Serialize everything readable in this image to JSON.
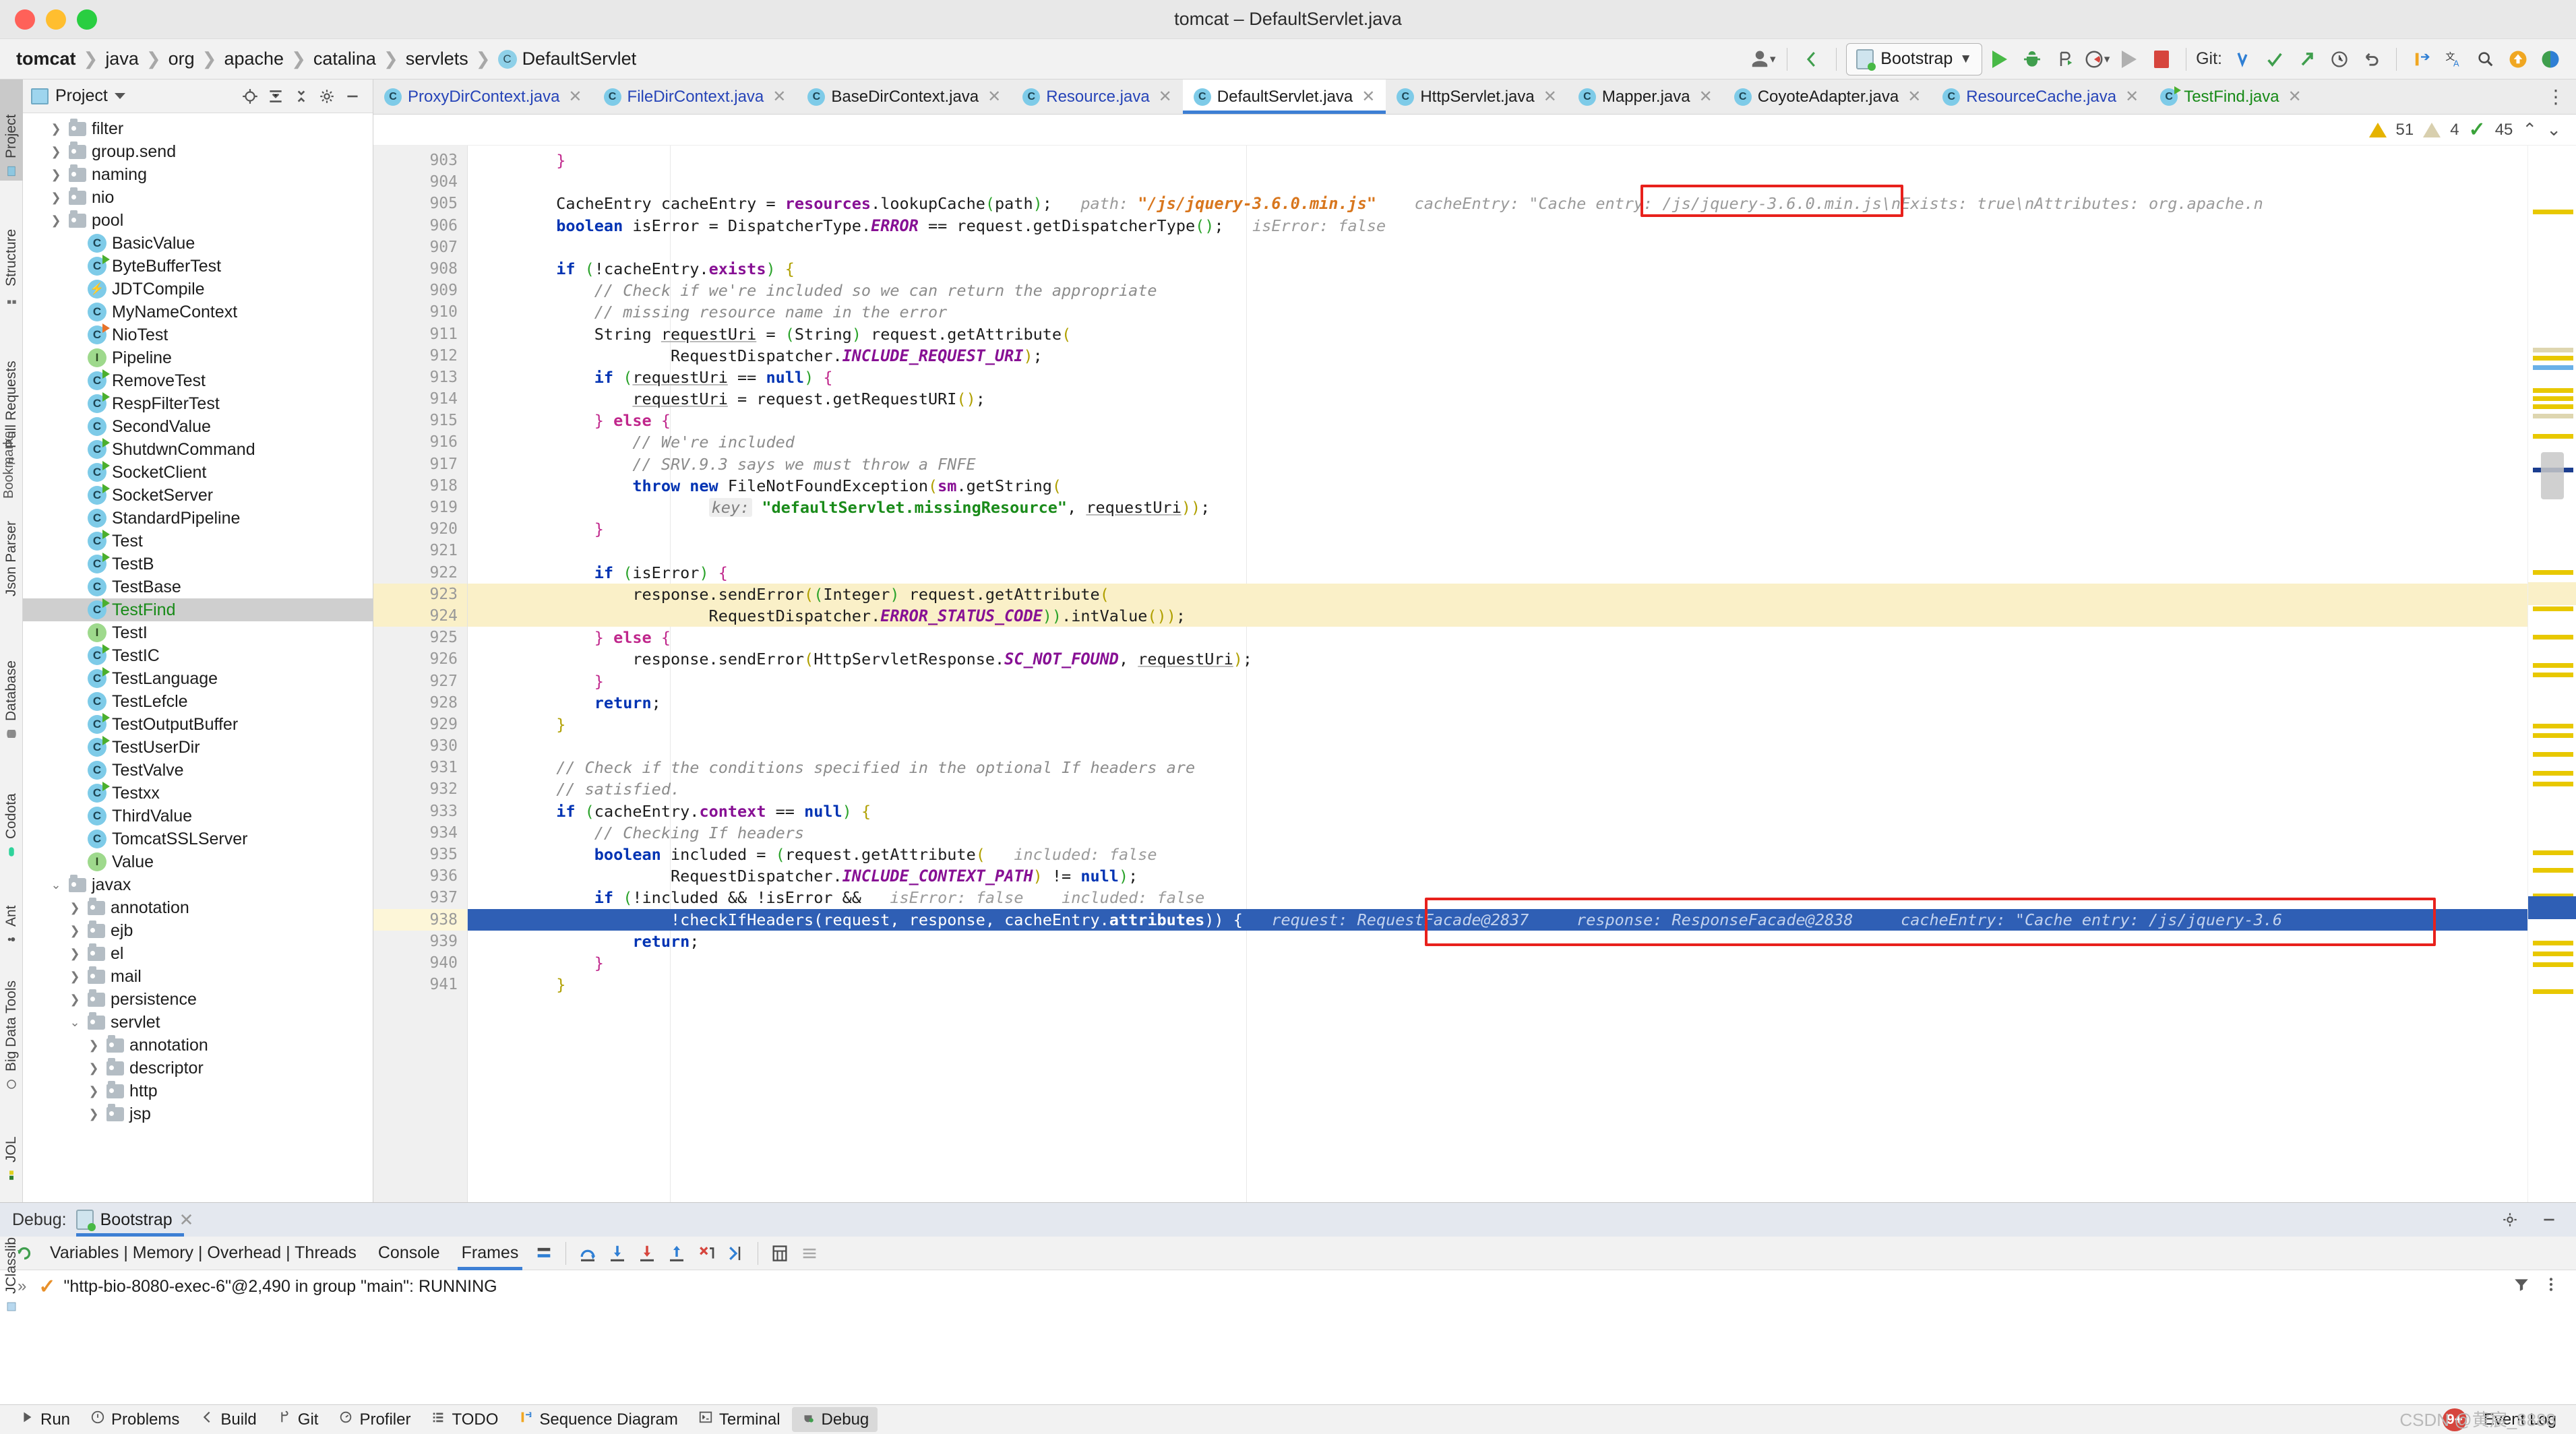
{
  "window": {
    "title": "tomcat – DefaultServlet.java",
    "traffic_lights": [
      "close",
      "minimize",
      "zoom"
    ]
  },
  "breadcrumb": {
    "items": [
      {
        "label": "tomcat",
        "bold": true
      },
      {
        "label": "java"
      },
      {
        "label": "org"
      },
      {
        "label": "apache"
      },
      {
        "label": "catalina"
      },
      {
        "label": "servlets"
      },
      {
        "label": "DefaultServlet",
        "icon": "class-icon"
      }
    ]
  },
  "toolbar": {
    "run_config": "Bootstrap",
    "git_label": "Git:",
    "icons": [
      "user-avatar-icon",
      "back-arrow-icon",
      "run-icon",
      "debug-icon",
      "run-with-coverage-icon",
      "profile-icon",
      "attach-icon",
      "stop-icon",
      "git-update-icon",
      "git-commit-icon",
      "git-push-icon",
      "git-history-icon",
      "git-rollback-icon",
      "git-branch-icon",
      "translate-icon",
      "search-icon",
      "update-icon",
      "settings-icon"
    ]
  },
  "left_tool_tabs": [
    {
      "label": "Project",
      "active": true,
      "icon": "project-icon"
    },
    {
      "label": "Structure",
      "active": false,
      "icon": "structure-icon"
    },
    {
      "label": "Pull Requests",
      "active": false,
      "icon": "pull-request-icon"
    },
    {
      "label": "Json Parser",
      "active": false,
      "icon": "json-icon"
    },
    {
      "label": "Database",
      "active": false,
      "icon": "database-icon"
    },
    {
      "label": "Codota",
      "active": false,
      "icon": "codota-icon"
    },
    {
      "label": "Ant",
      "active": false,
      "icon": "ant-icon"
    },
    {
      "label": "Big Data Tools",
      "active": false,
      "icon": "bigdata-icon"
    },
    {
      "label": "JOL",
      "active": false,
      "icon": "jol-icon"
    },
    {
      "label": "JClasslib",
      "active": false,
      "icon": "jclasslib-icon"
    }
  ],
  "project_panel": {
    "title": "Project",
    "header_icons": [
      "locate-icon",
      "expand-all-icon",
      "collapse-all-icon",
      "gear-icon",
      "hide-icon"
    ],
    "tree": [
      {
        "label": "filter",
        "type": "folder",
        "depth": 1,
        "arrow": "collapsed"
      },
      {
        "label": "group.send",
        "type": "folder",
        "depth": 1,
        "arrow": "collapsed"
      },
      {
        "label": "naming",
        "type": "folder",
        "depth": 1,
        "arrow": "collapsed"
      },
      {
        "label": "nio",
        "type": "folder",
        "depth": 1,
        "arrow": "collapsed"
      },
      {
        "label": "pool",
        "type": "folder",
        "depth": 1,
        "arrow": "collapsed"
      },
      {
        "label": "BasicValue",
        "type": "class",
        "depth": 2
      },
      {
        "label": "ByteBufferTest",
        "type": "class-runnable",
        "depth": 2
      },
      {
        "label": "JDTCompile",
        "type": "bolt",
        "depth": 2
      },
      {
        "label": "MyNameContext",
        "type": "class",
        "depth": 2
      },
      {
        "label": "NioTest",
        "type": "class-runnable-orange",
        "depth": 2
      },
      {
        "label": "Pipeline",
        "type": "interface",
        "depth": 2
      },
      {
        "label": "RemoveTest",
        "type": "class-runnable",
        "depth": 2
      },
      {
        "label": "RespFilterTest",
        "type": "class-runnable",
        "depth": 2
      },
      {
        "label": "SecondValue",
        "type": "class",
        "depth": 2
      },
      {
        "label": "ShutdwnCommand",
        "type": "class-runnable",
        "depth": 2
      },
      {
        "label": "SocketClient",
        "type": "class-runnable",
        "depth": 2
      },
      {
        "label": "SocketServer",
        "type": "class-runnable",
        "depth": 2
      },
      {
        "label": "StandardPipeline",
        "type": "class",
        "depth": 2
      },
      {
        "label": "Test",
        "type": "class-runnable",
        "depth": 2
      },
      {
        "label": "TestB",
        "type": "class-runnable",
        "depth": 2
      },
      {
        "label": "TestBase",
        "type": "class",
        "depth": 2
      },
      {
        "label": "TestFind",
        "type": "class-runnable",
        "depth": 2,
        "selected": true
      },
      {
        "label": "TestI",
        "type": "interface",
        "depth": 2
      },
      {
        "label": "TestIC",
        "type": "class-runnable",
        "depth": 2
      },
      {
        "label": "TestLanguage",
        "type": "class-runnable",
        "depth": 2
      },
      {
        "label": "TestLefcle",
        "type": "class",
        "depth": 2
      },
      {
        "label": "TestOutputBuffer",
        "type": "class-runnable",
        "depth": 2
      },
      {
        "label": "TestUserDir",
        "type": "class-runnable",
        "depth": 2
      },
      {
        "label": "TestValve",
        "type": "class",
        "depth": 2
      },
      {
        "label": "Testxx",
        "type": "class-runnable",
        "depth": 2
      },
      {
        "label": "ThirdValue",
        "type": "class",
        "depth": 2
      },
      {
        "label": "TomcatSSLServer",
        "type": "class",
        "depth": 2
      },
      {
        "label": "Value",
        "type": "interface",
        "depth": 2
      },
      {
        "label": "javax",
        "type": "folder",
        "depth": 1,
        "arrow": "expanded"
      },
      {
        "label": "annotation",
        "type": "folder",
        "depth": 2,
        "arrow": "collapsed"
      },
      {
        "label": "ejb",
        "type": "folder",
        "depth": 2,
        "arrow": "collapsed"
      },
      {
        "label": "el",
        "type": "folder",
        "depth": 2,
        "arrow": "collapsed"
      },
      {
        "label": "mail",
        "type": "folder",
        "depth": 2,
        "arrow": "collapsed"
      },
      {
        "label": "persistence",
        "type": "folder",
        "depth": 2,
        "arrow": "collapsed"
      },
      {
        "label": "servlet",
        "type": "folder",
        "depth": 2,
        "arrow": "expanded"
      },
      {
        "label": "annotation",
        "type": "folder",
        "depth": 3,
        "arrow": "collapsed"
      },
      {
        "label": "descriptor",
        "type": "folder",
        "depth": 3,
        "arrow": "collapsed"
      },
      {
        "label": "http",
        "type": "folder",
        "depth": 3,
        "arrow": "collapsed"
      },
      {
        "label": "jsp",
        "type": "folder",
        "depth": 3,
        "arrow": "collapsed"
      }
    ]
  },
  "editor_tabs": [
    {
      "label": "ProxyDirContext.java",
      "active": false,
      "color": "blue"
    },
    {
      "label": "FileDirContext.java",
      "active": false,
      "color": "blue"
    },
    {
      "label": "BaseDirContext.java",
      "active": false,
      "color": "black"
    },
    {
      "label": "Resource.java",
      "active": false,
      "color": "blue"
    },
    {
      "label": "DefaultServlet.java",
      "active": true,
      "color": "black"
    },
    {
      "label": "HttpServlet.java",
      "active": false,
      "color": "black"
    },
    {
      "label": "Mapper.java",
      "active": false,
      "color": "black"
    },
    {
      "label": "CoyoteAdapter.java",
      "active": false,
      "color": "black"
    },
    {
      "label": "ResourceCache.java",
      "active": false,
      "color": "blue"
    },
    {
      "label": "TestFind.java",
      "active": false,
      "color": "green"
    }
  ],
  "inspection": {
    "warnings": "51",
    "weak_warnings": "4",
    "passed": "45"
  },
  "code": {
    "first_line_number": 903,
    "highlighted_execution_line": 938,
    "search_highlight_lines": [
      923,
      924
    ],
    "lines": [
      {
        "n": 903,
        "html": "        <span class='par3'>}</span>"
      },
      {
        "n": 904,
        "html": ""
      },
      {
        "n": 905,
        "html": "        CacheEntry cacheEntry = <span class='fld'>resources</span>.lookupCache<span class='par2'>(</span>path<span class='par2'>)</span>;   <span class='hint'>path:</span> <span class='orangestr'>\"/js/jquery-3.6.0.min.js\"</span>    <span class='hint'>cacheEntry: \"Cache entry: /js/jquery-3.6.0.min.js\\nExists: true\\nAttributes: org.apache.n</span>"
      },
      {
        "n": 906,
        "html": "        <span class='kw'>boolean</span> isError = DispatcherType.<span class='fldi'>ERROR</span> == request.getDispatcherType<span class='par2'>()</span>;   <span class='hint'>isError: false</span>"
      },
      {
        "n": 907,
        "html": ""
      },
      {
        "n": 908,
        "html": "        <span class='kw'>if</span> <span class='par2'>(</span>!cacheEntry.<span class='fld'>exists</span><span class='par2'>)</span> <span class='par'>{</span>"
      },
      {
        "n": 909,
        "html": "            <span class='cmt'>// Check if we're included so we can return the appropriate</span>"
      },
      {
        "n": 910,
        "html": "            <span class='cmt'>// missing resource name in the error</span>"
      },
      {
        "n": 911,
        "html": "            String <span class='und'>requestUri</span> = <span class='par2'>(</span>String<span class='par2'>)</span> request.getAttribute<span class='par'>(</span>"
      },
      {
        "n": 912,
        "html": "                    RequestDispatcher.<span class='fldi'>INCLUDE_REQUEST_URI</span><span class='par'>)</span>;"
      },
      {
        "n": 913,
        "html": "            <span class='kw'>if</span> <span class='par2'>(</span><span class='und'>requestUri</span> == <span class='kw'>null</span><span class='par2'>)</span> <span class='par3'>{</span>"
      },
      {
        "n": 914,
        "html": "                <span class='und'>requestUri</span> = request.getRequestURI<span class='par'>()</span>;"
      },
      {
        "n": 915,
        "html": "            <span class='par3'>}</span> <span class='kw2'>else</span> <span class='par3'>{</span>"
      },
      {
        "n": 916,
        "html": "                <span class='cmt'>// We're included</span>"
      },
      {
        "n": 917,
        "html": "                <span class='cmt'>// SRV.9.3 says we must throw a FNFE</span>"
      },
      {
        "n": 918,
        "html": "                <span class='kw'>throw new</span> FileNotFoundException<span class='par'>(</span><span class='fld'>sm</span>.getString<span class='par'>(</span>"
      },
      {
        "n": 919,
        "html": "                        <span class='hintk'>key:</span> <span class='str'>\"defaultServlet.missingResource\"</span>, <span class='und'>requestUri</span><span class='par'>))</span>;"
      },
      {
        "n": 920,
        "html": "            <span class='par3'>}</span>"
      },
      {
        "n": 921,
        "html": ""
      },
      {
        "n": 922,
        "html": "            <span class='kw'>if</span> <span class='par2'>(</span>isError<span class='par2'>)</span> <span class='par3'>{</span>"
      },
      {
        "n": 923,
        "html": "                response.sendError<span class='par'>(</span><span class='par2'>(</span>Integer<span class='par2'>)</span> request.getAttribute<span class='par'>(</span>"
      },
      {
        "n": 924,
        "html": "                        RequestDispatcher.<span class='fldi'>ERROR_STATUS_CODE</span><span class='par2'>))</span>.intValue<span class='par'>()</span><span class='par'>)</span>;"
      },
      {
        "n": 925,
        "html": "            <span class='par3'>}</span> <span class='kw2'>else</span> <span class='par3'>{</span>"
      },
      {
        "n": 926,
        "html": "                response.sendError<span class='par'>(</span>HttpServletResponse.<span class='fldi'>SC_NOT_FOUND</span>, <span class='und'>requestUri</span><span class='par'>)</span>;"
      },
      {
        "n": 927,
        "html": "            <span class='par3'>}</span>"
      },
      {
        "n": 928,
        "html": "            <span class='kw'>return</span>;"
      },
      {
        "n": 929,
        "html": "        <span class='par'>}</span>"
      },
      {
        "n": 930,
        "html": ""
      },
      {
        "n": 931,
        "html": "        <span class='cmt'>// Check if the conditions specified in the optional If headers are</span>"
      },
      {
        "n": 932,
        "html": "        <span class='cmt'>// satisfied.</span>"
      },
      {
        "n": 933,
        "html": "        <span class='kw'>if</span> <span class='par2'>(</span>cacheEntry.<span class='fld'>context</span> == <span class='kw'>null</span><span class='par2'>)</span> <span class='par'>{</span>"
      },
      {
        "n": 934,
        "html": "            <span class='cmt'>// Checking If headers</span>"
      },
      {
        "n": 935,
        "html": "            <span class='kw'>boolean</span> included = <span class='par2'>(</span>request.getAttribute<span class='par'>(</span>   <span class='hint'>included: false</span>"
      },
      {
        "n": 936,
        "html": "                    RequestDispatcher.<span class='fldi'>INCLUDE_CONTEXT_PATH</span><span class='par'>)</span> != <span class='kw'>null</span><span class='par2'>)</span>;"
      },
      {
        "n": 937,
        "html": "            <span class='kw'>if</span> <span class='par2'>(</span>!included &amp;&amp; !isError &amp;&amp;   <span class='hint'>isError: false    included: false</span>"
      },
      {
        "n": 938,
        "html": "                    !checkIfHeaders(request, response, cacheEntry.<span class='fld'>attributes</span>)) {   <span class='hint'>request: RequestFacade@2837     response: ResponseFacade@2838     cacheEntry: \"Cache entry: /js/jquery-3.6</span>"
      },
      {
        "n": 939,
        "html": "                <span class='kw'>return</span>;"
      },
      {
        "n": 940,
        "html": "            <span class='par3'>}</span>"
      },
      {
        "n": 941,
        "html": "        <span class='par'>}</span>"
      }
    ],
    "inline_hints": {
      "path_value": "\"/js/jquery-3.6.0.min.js\"",
      "cache_entry_value": "cacheEntry: \"Cache entry: /js/jquery-3.6.0.min.js\\nExists: true\\nAttributes: org.apache.n",
      "is_error": "isError: false",
      "included": "included: false",
      "request_facade": "request: RequestFacade@2837",
      "response_facade": "response: ResponseFacade@2838"
    }
  },
  "debug_panel": {
    "label": "Debug:",
    "config_name": "Bootstrap",
    "tabs": [
      {
        "label": "Variables | Memory | Overhead | Threads",
        "active": false
      },
      {
        "label": "Console",
        "active": false
      },
      {
        "label": "Frames",
        "active": true
      }
    ],
    "step_icons": [
      "rerun-icon",
      "layout-icon",
      "step-over-icon",
      "step-into-icon",
      "force-step-into-icon",
      "step-out-icon",
      "drop-frame-icon",
      "run-to-cursor-icon",
      "evaluate-icon",
      "mute-breakpoints-icon"
    ],
    "frame_text": "\"http-bio-8080-exec-6\"@2,490 in group \"main\": RUNNING",
    "settings_icons": [
      "gear-icon",
      "hide-icon",
      "filter-icon",
      "more-icon"
    ]
  },
  "status_bar": {
    "items": [
      {
        "label": "Run",
        "icon": "run-icon",
        "active": false
      },
      {
        "label": "Problems",
        "icon": "problems-icon",
        "active": false
      },
      {
        "label": "Build",
        "icon": "build-icon",
        "active": false
      },
      {
        "label": "Git",
        "icon": "git-icon",
        "active": false
      },
      {
        "label": "Profiler",
        "icon": "profiler-icon",
        "active": false
      },
      {
        "label": "TODO",
        "icon": "todo-icon",
        "active": false
      },
      {
        "label": "Sequence Diagram",
        "icon": "sequence-diagram-icon",
        "active": false
      },
      {
        "label": "Terminal",
        "icon": "terminal-icon",
        "active": false
      },
      {
        "label": "Debug",
        "icon": "debug-icon",
        "active": true
      }
    ],
    "event_log": {
      "label": "Event Log",
      "badge": "9+"
    },
    "bookmarks_tab": "Bookmarks"
  },
  "watermark": "CSDN @黄宸_8888",
  "colors": {
    "accent": "#3d7fd4",
    "exec_line": "#2f5fb5",
    "search_highlight": "#faf0c8",
    "red_annotation": "#e8211c",
    "keyword": "#0033b3",
    "string": "#1a8b1a",
    "field": "#871094",
    "comment": "#8c8c8c"
  }
}
